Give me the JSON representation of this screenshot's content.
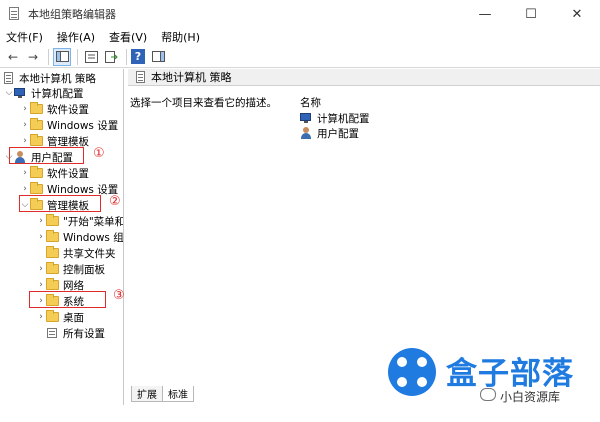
{
  "window": {
    "title": "本地组策略编辑器",
    "controls": {
      "minimize": "—",
      "maximize": "☐",
      "close": "✕"
    }
  },
  "menu": [
    "文件(F)",
    "操作(A)",
    "查看(V)",
    "帮助(H)"
  ],
  "toolbar": {
    "back": "←",
    "forward": "→",
    "help": "?"
  },
  "tree": {
    "root": "本地计算机 策略",
    "computer_config": "计算机配置",
    "cc_software": "软件设置",
    "cc_windows": "Windows 设置",
    "cc_admin": "管理模板",
    "user_config": "用户配置",
    "uc_software": "软件设置",
    "uc_windows": "Windows 设置",
    "uc_admin": "管理模板",
    "start_menu": "\"开始\"菜单和",
    "windows_comp": "Windows 组",
    "shared_folders": "共享文件夹",
    "control_panel": "控制面板",
    "network": "网络",
    "system": "系统",
    "desktop": "桌面",
    "all_settings": "所有设置"
  },
  "annotations": [
    "①",
    "②",
    "③"
  ],
  "annotation_color": "#e02b2b",
  "right": {
    "header": "本地计算机 策略",
    "description": "选择一个项目来查看它的描述。",
    "column_name": "名称",
    "items": [
      "计算机配置",
      "用户配置"
    ]
  },
  "tabs": [
    "扩展",
    "标准"
  ],
  "watermark": {
    "brand": "盒子部落",
    "sub": "小白资源库",
    "color": "#1f7be0"
  }
}
